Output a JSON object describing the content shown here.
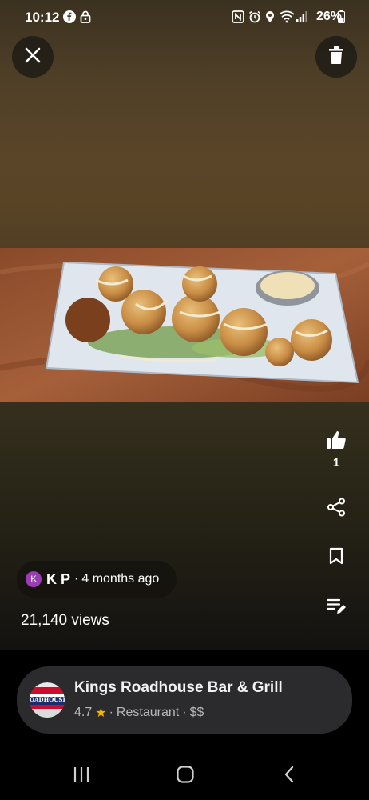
{
  "status_bar": {
    "time": "10:12",
    "battery": "26%",
    "left_icons": [
      "facebook-icon",
      "lock-icon"
    ],
    "right_icons": [
      "nfc-icon",
      "alarm-icon",
      "location-icon",
      "wifi-icon",
      "signal-icon",
      "battery-icon"
    ]
  },
  "top_bar": {
    "close_icon": "close-icon",
    "delete_icon": "trash-icon"
  },
  "photo": {
    "subject": "food-photo"
  },
  "actions": {
    "like_count": "1",
    "icons": [
      "thumbs-up-icon",
      "share-icon",
      "bookmark-icon",
      "edit-list-icon"
    ]
  },
  "author": {
    "avatar_initial": "K",
    "name": "K P",
    "separator": "·",
    "posted": "4 months ago",
    "avatar_color": "#9b3bb5"
  },
  "views": "21,140 views",
  "place": {
    "name": "Kings Roadhouse Bar & Grill",
    "rating": "4.7",
    "separator1": "·",
    "category": "Restaurant",
    "separator2": "·",
    "price": "$$",
    "star_color": "#f5b301",
    "logo_text": "OADHOUSE"
  },
  "nav": {
    "icons": [
      "recent-apps-icon",
      "home-icon",
      "back-icon"
    ]
  }
}
